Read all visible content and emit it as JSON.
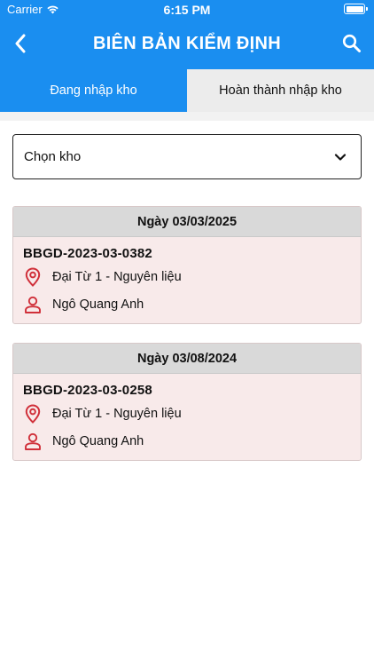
{
  "status_bar": {
    "carrier": "Carrier",
    "time": "6:15 PM"
  },
  "header": {
    "title": "BIÊN BẢN KIỂM ĐỊNH",
    "back_icon": "chevron-left-icon",
    "search_icon": "search-icon",
    "background_color": "#1a8ef0"
  },
  "tabs": [
    {
      "label": "Đang nhập kho",
      "active": true
    },
    {
      "label": "Hoàn thành nhập kho",
      "active": false
    }
  ],
  "warehouse_select": {
    "value": "Chọn kho",
    "icon": "chevron-down-icon"
  },
  "records": [
    {
      "date": "Ngày 03/03/2025",
      "code": "BBGD-2023-03-0382",
      "location": "Đại Từ 1 - Nguyên liệu",
      "person": "Ngô Quang Anh"
    },
    {
      "date": "Ngày 03/08/2024",
      "code": "BBGD-2023-03-0258",
      "location": "Đại Từ 1 - Nguyên liệu",
      "person": "Ngô Quang Anh"
    }
  ],
  "colors": {
    "accent": "#1a8ef0",
    "icon_red": "#d0303a",
    "card_bg": "#f8eaea",
    "card_header_bg": "#d9d9d9"
  }
}
